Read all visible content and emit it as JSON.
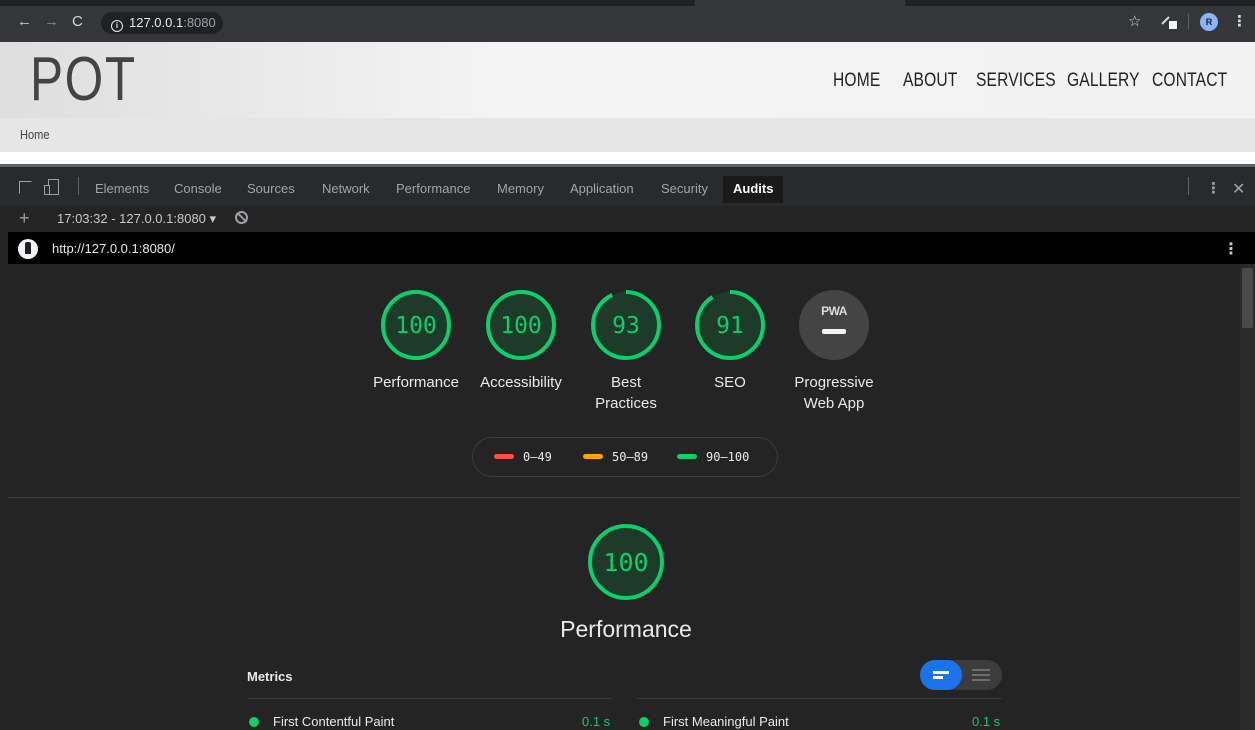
{
  "browser": {
    "url_host": "127.0.0.1",
    "url_port": ":8080",
    "profile_initial": "R"
  },
  "site": {
    "logo": "POT",
    "nav": [
      "HOME",
      "ABOUT",
      "SERVICES",
      "GALLERY",
      "CONTACT"
    ],
    "breadcrumb": "Home"
  },
  "devtools": {
    "tabs": [
      "Elements",
      "Console",
      "Sources",
      "Network",
      "Performance",
      "Memory",
      "Application",
      "Security",
      "Audits"
    ],
    "active_tab": "Audits",
    "report_selector": "17:03:32 - 127.0.0.1:8080 ▾"
  },
  "lighthouse": {
    "url": "http://127.0.0.1:8080/",
    "categories": [
      {
        "label_lines": [
          "Performance"
        ],
        "score": 100
      },
      {
        "label_lines": [
          "Accessibility"
        ],
        "score": 100
      },
      {
        "label_lines": [
          "Best",
          "Practices"
        ],
        "score": 93
      },
      {
        "label_lines": [
          "SEO"
        ],
        "score": 91
      }
    ],
    "pwa": {
      "badge_text": "PWA",
      "label_lines": [
        "Progressive",
        "Web App"
      ]
    },
    "legend": [
      {
        "range": "0–49",
        "color": "#ff4e42"
      },
      {
        "range": "50–89",
        "color": "#ffa400"
      },
      {
        "range": "90–100",
        "color": "#0cce6b"
      }
    ],
    "score_color": "#0cce6b",
    "main_category": {
      "title": "Performance",
      "score": 100
    },
    "metrics_title": "Metrics",
    "metrics": [
      {
        "name": "First Contentful Paint",
        "value": "0.1 s"
      },
      {
        "name": "First Meaningful Paint",
        "value": "0.1 s"
      }
    ]
  }
}
